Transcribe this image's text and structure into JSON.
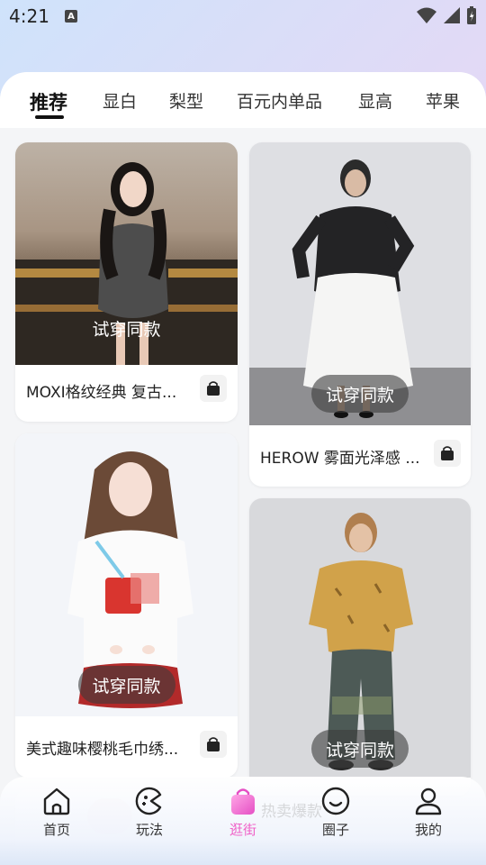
{
  "status": {
    "time": "4:21",
    "notify_badge": "A"
  },
  "tabs": [
    "推荐",
    "显白",
    "梨型",
    "百元内单品",
    "显高",
    "苹果"
  ],
  "cards": [
    {
      "title": "MOXI格纹经典 复古...",
      "tryon_label": "试穿同款"
    },
    {
      "title": "HEROW 雾面光泽感 ...",
      "tryon_label": "试穿同款"
    },
    {
      "title": "美式趣味樱桃毛巾绣...",
      "tryon_label": "试穿同款"
    },
    {
      "title": "",
      "tryon_label": "试穿同款"
    }
  ],
  "hidden_text": "热卖爆款",
  "nav": [
    {
      "label": "首页",
      "icon": "home-icon"
    },
    {
      "label": "玩法",
      "icon": "game-icon"
    },
    {
      "label": "逛街",
      "icon": "shopping-bag-icon"
    },
    {
      "label": "圈子",
      "icon": "smile-icon"
    },
    {
      "label": "我的",
      "icon": "profile-icon"
    }
  ],
  "colors": {
    "accent": "#f062c8",
    "active_tab": "#111111"
  }
}
